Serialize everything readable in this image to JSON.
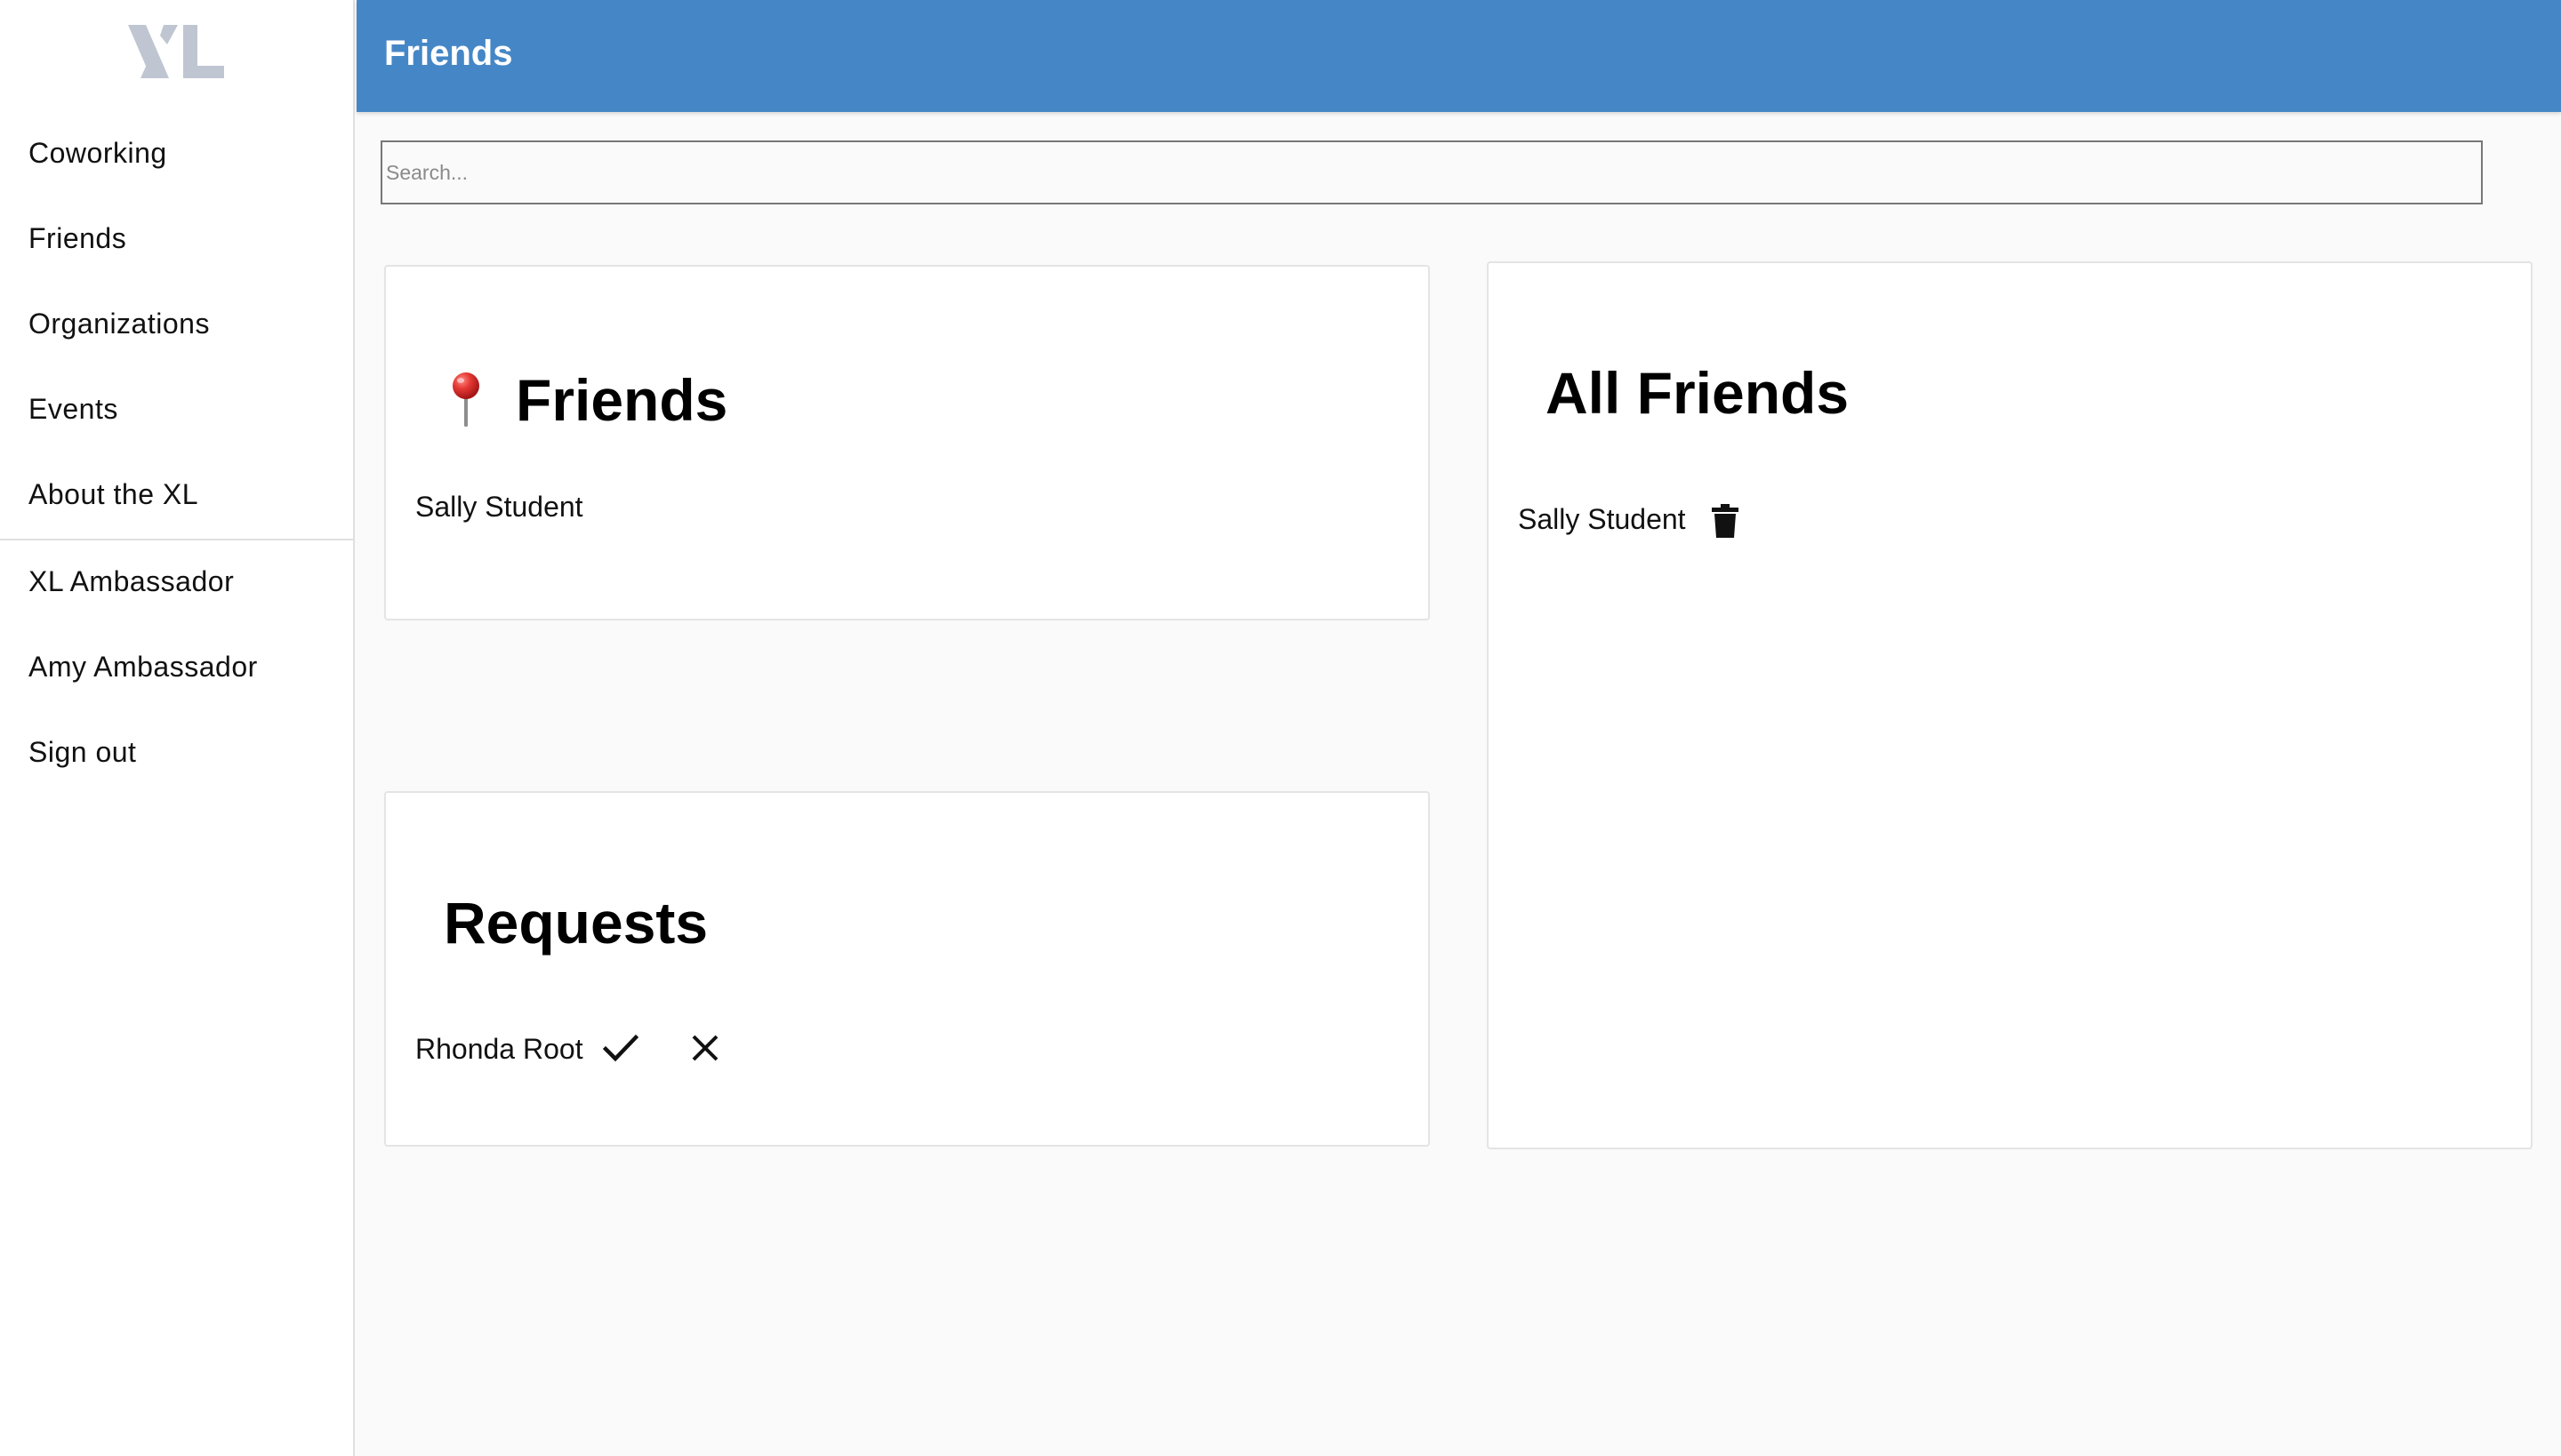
{
  "sidebar": {
    "logo": "XL",
    "items": [
      {
        "label": "Coworking"
      },
      {
        "label": "Friends"
      },
      {
        "label": "Organizations"
      },
      {
        "label": "Events"
      },
      {
        "label": "About the XL"
      },
      {
        "label": "XL Ambassador"
      },
      {
        "label": "Amy Ambassador"
      },
      {
        "label": "Sign out"
      }
    ]
  },
  "header": {
    "title": "Friends"
  },
  "search": {
    "placeholder": "Search...",
    "value": ""
  },
  "friends_card": {
    "icon": "pushpin-icon",
    "title": "Friends",
    "items": [
      {
        "name": "Sally Student"
      }
    ]
  },
  "requests_card": {
    "title": "Requests",
    "items": [
      {
        "name": "Rhonda Root",
        "accept_icon": "check-icon",
        "decline_icon": "close-icon"
      }
    ]
  },
  "all_friends_card": {
    "title": "All Friends",
    "items": [
      {
        "name": "Sally Student",
        "delete_icon": "trash-icon"
      }
    ]
  },
  "colors": {
    "header_bg": "#4587c6",
    "page_bg": "#fafafa",
    "logo": "#bfc6d2",
    "pin_red": "#d32f2f"
  }
}
